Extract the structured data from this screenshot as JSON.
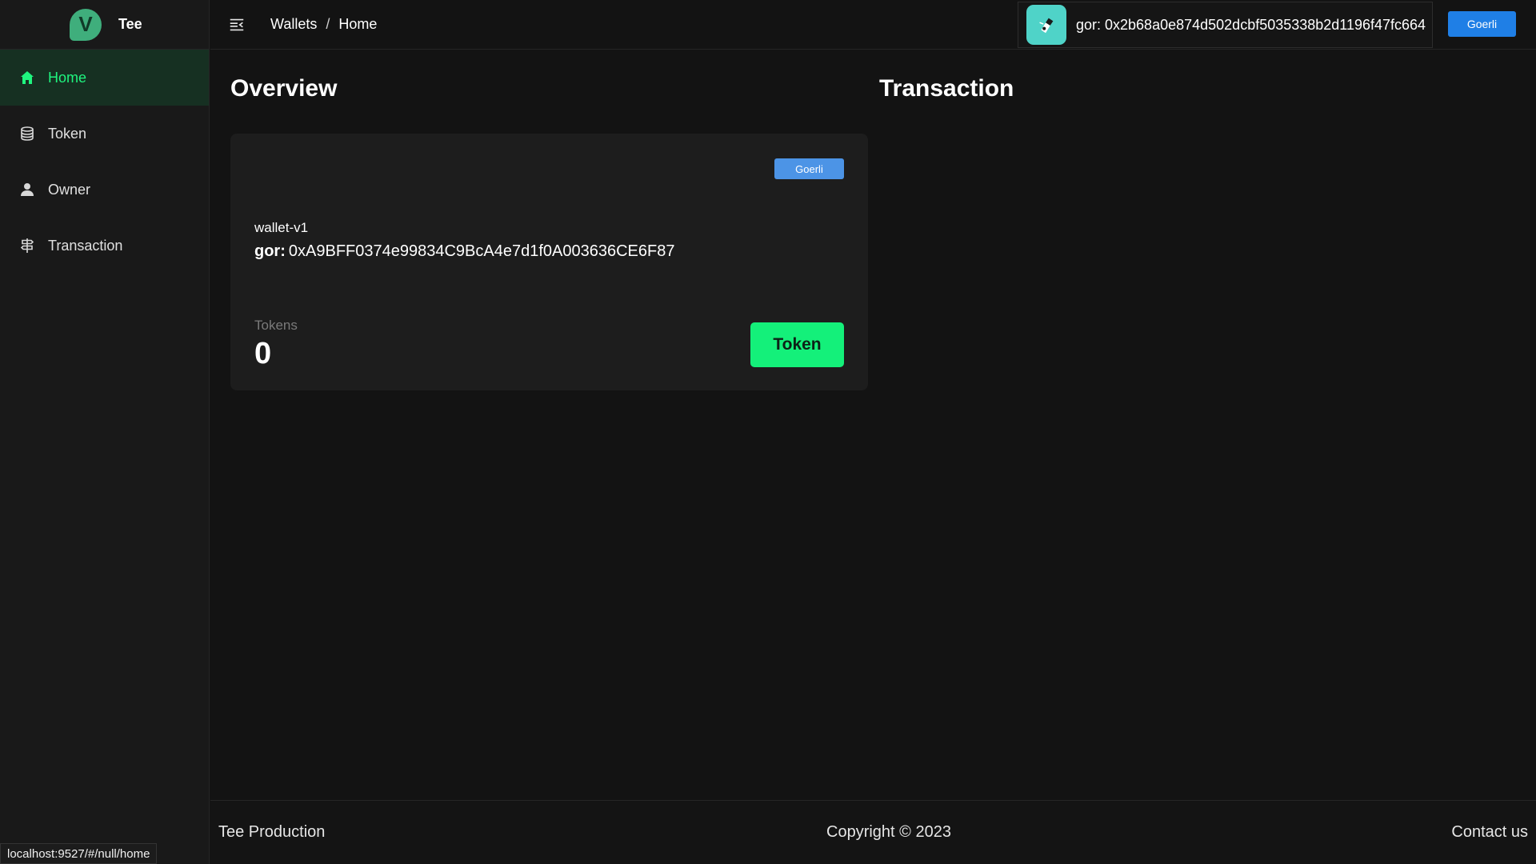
{
  "brand": {
    "logo_letter": "V",
    "name": "Tee"
  },
  "sidebar": {
    "items": [
      {
        "label": "Home",
        "icon": "home-icon",
        "active": true
      },
      {
        "label": "Token",
        "icon": "database-icon",
        "active": false
      },
      {
        "label": "Owner",
        "icon": "user-icon",
        "active": false
      },
      {
        "label": "Transaction",
        "icon": "signpost-icon",
        "active": false
      }
    ]
  },
  "header": {
    "breadcrumb": [
      "Wallets",
      "Home"
    ],
    "breadcrumb_separator": "/",
    "account_address": "gor: 0x2b68a0e874d502dcbf5035338b2d1196f47fc664",
    "network_button": "Goerli"
  },
  "main": {
    "overview_title": "Overview",
    "transaction_title": "Transaction",
    "wallet_card": {
      "network_chip": "Goerli",
      "wallet_name": "wallet-v1",
      "address_prefix": "gor:",
      "address": "0xA9BFF0374e99834C9BcA4e7d1f0A003636CE6F87",
      "tokens_label": "Tokens",
      "tokens_count": "0",
      "token_button": "Token"
    }
  },
  "footer": {
    "left": "Tee Production",
    "center": "Copyright © 2023",
    "right": "Contact us"
  },
  "status_bar": {
    "url": "localhost:9527/#/null/home"
  },
  "colors": {
    "accent_green": "#14f07a",
    "active_nav_text": "#1ff57f",
    "network_blue": "#1f7fe6",
    "chip_blue": "#4c94e6",
    "background": "#131313"
  }
}
